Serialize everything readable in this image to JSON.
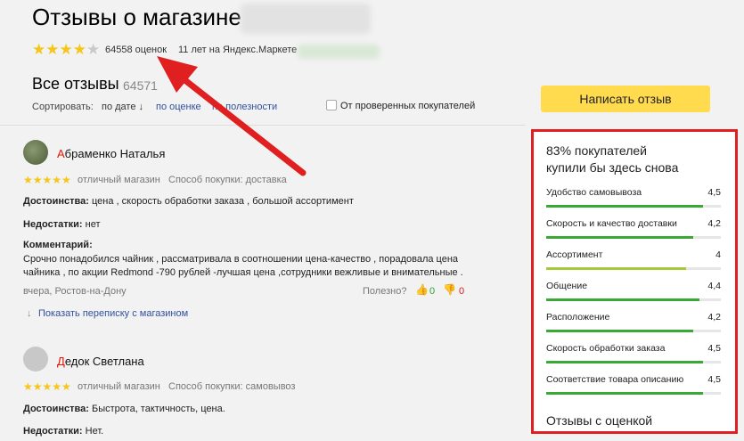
{
  "header": {
    "title": "Отзывы о магазине",
    "rating_count": "64558 оценок",
    "years": "11 лет на Яндекс.Маркете",
    "rating": 4
  },
  "reviews_section": {
    "title": "Все отзывы",
    "count": "64571",
    "sort_label": "Сортировать:",
    "sort_date": "по дате ↓",
    "sort_rating": "по оценке",
    "sort_useful": "по полезности",
    "verified_label": "От проверенных покупателей",
    "write_button": "Написать отзыв"
  },
  "reviews": [
    {
      "name_first": "А",
      "name_rest": "браменко Наталья",
      "rating": 5,
      "verdict": "отличный магазин",
      "purchase": "Способ покупки: доставка",
      "pros_label": "Достоинства:",
      "pros": "цена , скорость обработки заказа , большой ассортимент",
      "cons_label": "Недостатки:",
      "cons": "нет",
      "comment_label": "Комментарий:",
      "comment_line1": "Срочно понадобился чайник , рассматривала в соотношении цена-качество , порадовала цена",
      "comment_line2": "чайника , по акции Redmond -790 рублей -лучшая цена ,сотрудники вежливые и внимательные .",
      "meta": "вчера, Ростов-на-Дону",
      "useful_label": "Полезно?",
      "likes": "0",
      "dislikes": "0",
      "show_thread": "Показать переписку с магазином"
    },
    {
      "name_first": "Д",
      "name_rest": "едок Светлана",
      "rating": 5,
      "verdict": "отличный магазин",
      "purchase": "Способ покупки: самовывоз",
      "pros_label": "Достоинства:",
      "pros": "Быстрота, тактичность, цена.",
      "cons_label": "Недостатки:",
      "cons": "Нет."
    }
  ],
  "panel": {
    "headline_line1": "83% покупателей",
    "headline_line2": "купили бы здесь снова",
    "metrics": [
      {
        "label": "Удобство самовывоза",
        "value": "4,5",
        "fill": 0.9,
        "color": "#3aa935"
      },
      {
        "label": "Скорость и качество доставки",
        "value": "4,2",
        "fill": 0.84,
        "color": "#3aa935"
      },
      {
        "label": "Ассортимент",
        "value": "4",
        "fill": 0.8,
        "color": "#a6c93b"
      },
      {
        "label": "Общение",
        "value": "4,4",
        "fill": 0.88,
        "color": "#3aa935"
      },
      {
        "label": "Расположение",
        "value": "4,2",
        "fill": 0.84,
        "color": "#3aa935"
      },
      {
        "label": "Скорость обработки заказа",
        "value": "4,5",
        "fill": 0.9,
        "color": "#3aa935"
      },
      {
        "label": "Соответствие товара описанию",
        "value": "4,5",
        "fill": 0.9,
        "color": "#3aa935"
      }
    ],
    "footer": "Отзывы с оценкой"
  },
  "colors": {
    "accent_red": "#e02020",
    "button_yellow": "#ffdb4d",
    "star": "#f5c518",
    "link": "#3050a0"
  }
}
